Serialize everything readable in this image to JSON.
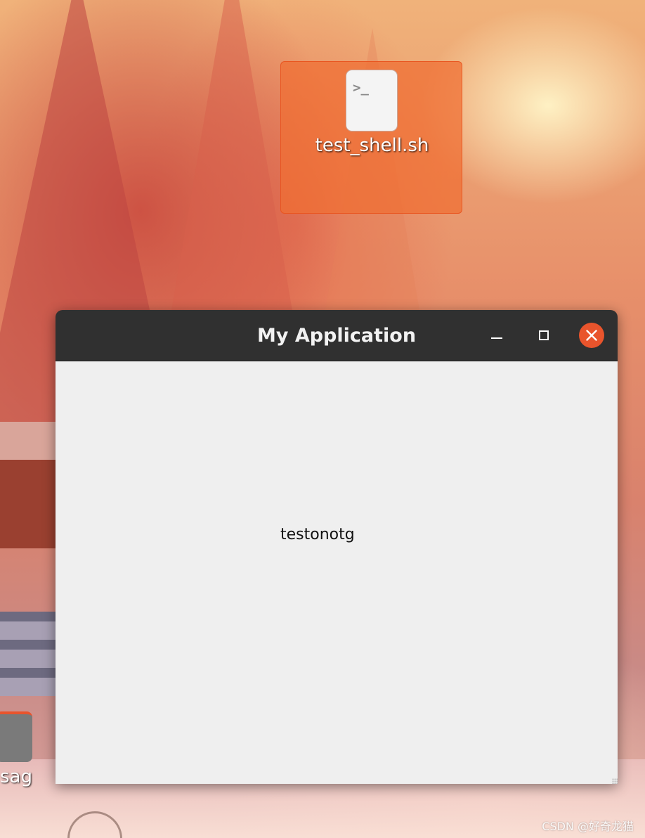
{
  "desktop": {
    "icons": [
      {
        "label": "test_shell.sh",
        "icon": "terminal-script-icon",
        "glyph": ">_",
        "selected": true
      },
      {
        "label": "sag",
        "icon": "folder-icon",
        "selected": false
      }
    ]
  },
  "window": {
    "title": "My Application",
    "controls": {
      "minimize": "minimize-icon",
      "maximize": "maximize-icon",
      "close": "close-icon"
    },
    "content_text": "testonotg"
  },
  "colors": {
    "accent": "#e9542c",
    "titlebar": "#303030",
    "window_bg": "#efefef"
  },
  "watermark": "CSDN @好奇龙猫"
}
